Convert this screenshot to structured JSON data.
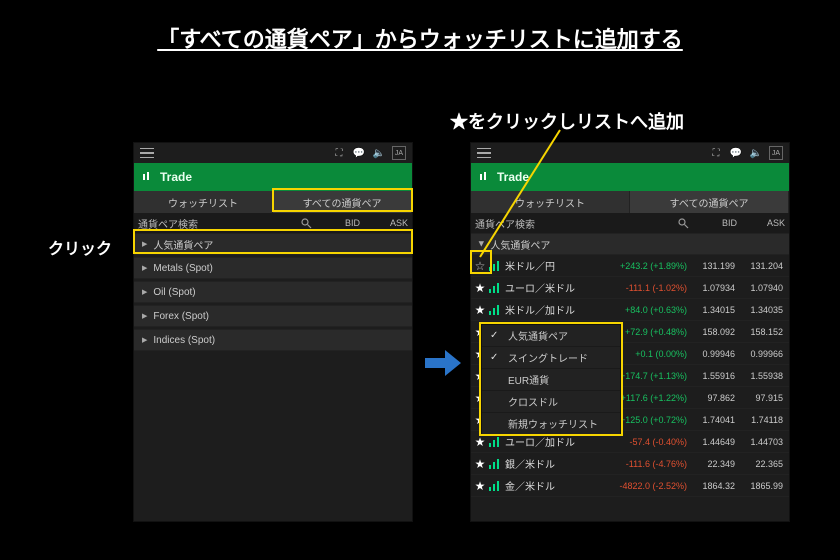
{
  "title": "「すべての通貨ペア」からウォッチリストに追加する",
  "subtitle": "★をクリックしリストへ追加",
  "click_label": "クリック",
  "common": {
    "trade_label": "Trade",
    "tab_watchlist": "ウォッチリスト",
    "tab_allpairs": "すべての通貨ペア",
    "search_placeholder": "通貨ペア検索",
    "hdr_bid": "BID",
    "hdr_ask": "ASK"
  },
  "left": {
    "categories": [
      "人気通貨ペア",
      "Metals (Spot)",
      "Oil (Spot)",
      "Forex (Spot)",
      "Indices (Spot)"
    ]
  },
  "right": {
    "top_category": "人気通貨ペア",
    "rows": [
      {
        "star": "outline",
        "pair": "米ドル／円",
        "chg": "+243.2 (+1.89%)",
        "dir": "up",
        "bid": "131.199",
        "ask": "131.204"
      },
      {
        "star": "filled",
        "pair": "ユーロ／米ドル",
        "chg": "-111.1 (-1.02%)",
        "dir": "down",
        "bid": "1.07934",
        "ask": "1.07940"
      },
      {
        "star": "filled",
        "pair": "米ドル／加ドル",
        "chg": "+84.0 (+0.63%)",
        "dir": "up",
        "bid": "1.34015",
        "ask": "1.34035"
      },
      {
        "star": "filled",
        "pair": "",
        "chg": "+72.9 (+0.48%)",
        "dir": "up",
        "bid": "158.092",
        "ask": "158.152"
      },
      {
        "star": "filled",
        "pair": "",
        "chg": "+0.1 (0.00%)",
        "dir": "up",
        "bid": "0.99946",
        "ask": "0.99966"
      },
      {
        "star": "filled",
        "pair": "",
        "chg": "+174.7 (+1.13%)",
        "dir": "up",
        "bid": "1.55916",
        "ask": "1.55938"
      },
      {
        "star": "filled",
        "pair": "",
        "chg": "+117.6 (+1.22%)",
        "dir": "up",
        "bid": "97.862",
        "ask": "97.915"
      },
      {
        "star": "filled",
        "pair": "",
        "chg": "+125.0 (+0.72%)",
        "dir": "up",
        "bid": "1.74041",
        "ask": "1.74118"
      },
      {
        "star": "filled",
        "pair": "ユーロ／加ドル",
        "chg": "-57.4 (-0.40%)",
        "dir": "down",
        "bid": "1.44649",
        "ask": "1.44703"
      },
      {
        "star": "filled",
        "pair": "銀／米ドル",
        "chg": "-111.6 (-4.76%)",
        "dir": "down",
        "bid": "22.349",
        "ask": "22.365"
      },
      {
        "star": "filled",
        "pair": "金／米ドル",
        "chg": "-4822.0 (-2.52%)",
        "dir": "down",
        "bid": "1864.32",
        "ask": "1865.99"
      }
    ],
    "popup": [
      {
        "checked": true,
        "label": "人気通貨ペア"
      },
      {
        "checked": true,
        "label": "スイングトレード"
      },
      {
        "checked": false,
        "label": "EUR通貨"
      },
      {
        "checked": false,
        "label": "クロスドル"
      },
      {
        "checked": false,
        "label": "新規ウォッチリスト"
      }
    ]
  }
}
